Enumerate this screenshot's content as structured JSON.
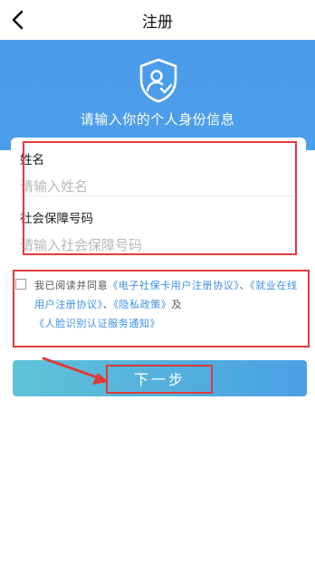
{
  "nav": {
    "title": "注册",
    "back_icon": "chevron-left-icon"
  },
  "banner": {
    "title": "请输入你的个人身份信息",
    "icon": "shield-user-check-icon"
  },
  "form": {
    "name_label": "姓名",
    "name_placeholder": "请输入姓名",
    "ssn_label": "社会保障号码",
    "ssn_placeholder": "请输入社会保障号码"
  },
  "agreement": {
    "checked": false,
    "prefix": "我已阅读并同意",
    "link1": "《电子社保卡用户注册协议》",
    "sep1": "、",
    "link2": "《就业在线用户注册协议》",
    "sep2": "、",
    "link3": "《隐私政策》",
    "and": "及",
    "link4": "《人脸识别认证服务通知》"
  },
  "next_button": {
    "label": "下一步"
  },
  "colors": {
    "primary": "#4a9ce9",
    "link": "#3d8fe3",
    "annotation": "#e23a3a"
  }
}
